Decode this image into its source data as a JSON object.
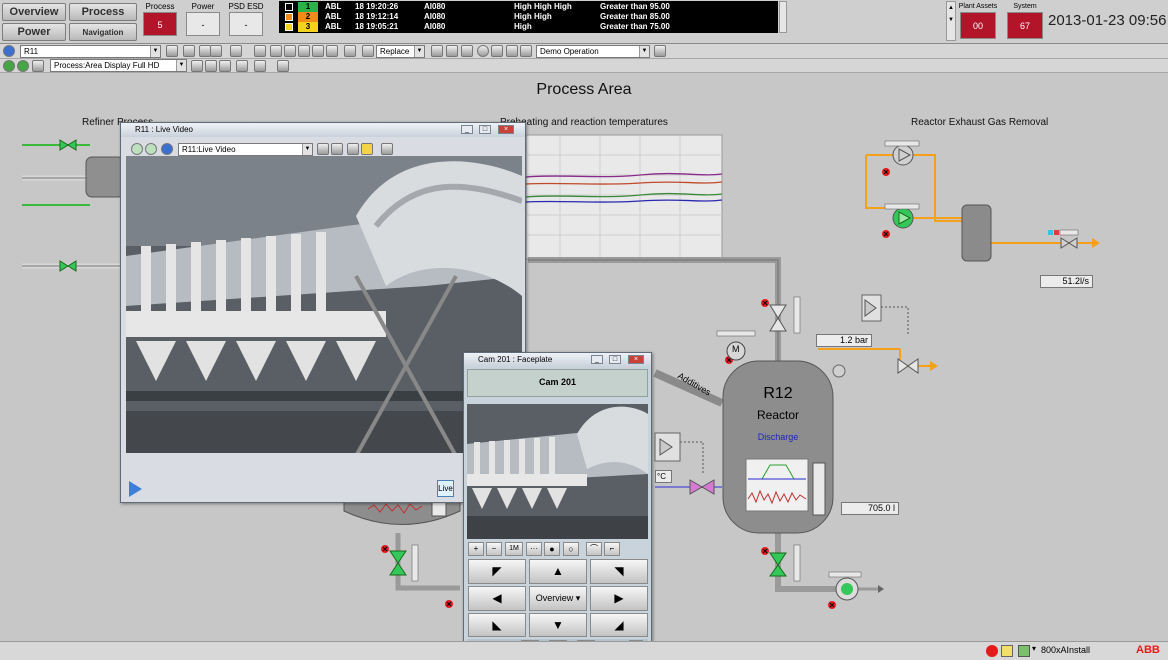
{
  "header": {
    "nav": {
      "overview": "Overview",
      "process": "Process",
      "power": "Power",
      "navigation_display": "Navigation Display"
    },
    "indicators": [
      {
        "label": "Process",
        "value": "5",
        "alarm": true
      },
      {
        "label": "Power",
        "value": "-",
        "alarm": false
      },
      {
        "label": "PSD ESD",
        "value": "-",
        "alarm": false
      }
    ],
    "alarms": [
      {
        "priority": "1",
        "source": "ABL",
        "time": "18 19:20:26",
        "object": "AI080",
        "condition": "High High High",
        "message": "Greater than 95.00",
        "color": "#2bb34a"
      },
      {
        "priority": "2",
        "source": "ABL",
        "time": "18 19:12:14",
        "object": "AI080",
        "condition": "High High",
        "message": "Greater than 85.00",
        "color": "#f28b17"
      },
      {
        "priority": "3",
        "source": "ABL",
        "time": "18 19:05:21",
        "object": "AI080",
        "condition": "High",
        "message": "Greater than 75.00",
        "color": "#f5d21c"
      }
    ],
    "status": [
      {
        "label": "Plant Assets",
        "value": "00"
      },
      {
        "label": "System",
        "value": "67"
      }
    ],
    "clock": "2013-01-23 09:56"
  },
  "toolbar1": {
    "object_combo": "R11",
    "replace_combo": "Replace",
    "workplace_combo": "Demo Operation"
  },
  "toolbar2": {
    "display_combo": "Process:Area Display Full HD"
  },
  "graphic": {
    "title": "Process Area",
    "sections": {
      "refiner": "Refiner Process",
      "preheat": "Preheating and reaction temperatures",
      "exhaust": "Reactor Exhaust Gas Removal"
    },
    "reactor": {
      "tag": "R12",
      "name": "Reactor",
      "sub": "Discharge",
      "level": "705.0",
      "level_unit": "l"
    },
    "flow": {
      "value": "51.2",
      "unit": "l/s"
    },
    "pressure": {
      "value": "1.2",
      "unit": "bar"
    },
    "temp_unit": "°C",
    "additives": "Additives",
    "motor": "M"
  },
  "live_video": {
    "title": "R11 : Live Video",
    "combo": "R11:Live Video",
    "live_button": "Live"
  },
  "faceplate": {
    "title": "Cam 201 : Faceplate",
    "header": "Cam 201",
    "zoom_1m": "1M",
    "preset": "Overview",
    "views": [
      "o",
      "oo",
      "ooo"
    ]
  },
  "statusbar": {
    "user": "800xAInstall",
    "brand": "ABB"
  },
  "colors": {
    "alarm_red": "#b2142a",
    "pipe_orange": "#f5a01a",
    "pipe_green": "#3cb93c",
    "valve_green": "#34c759",
    "valve_magenta": "#d77ad1",
    "discharge_blue": "#1d22c9"
  }
}
